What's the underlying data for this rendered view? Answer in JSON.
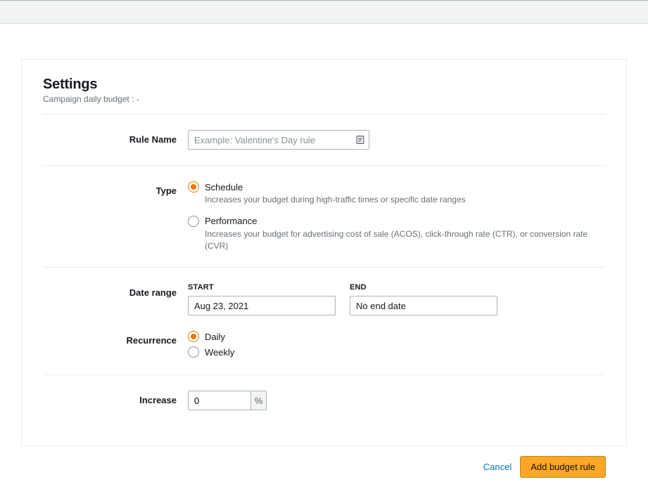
{
  "panel": {
    "title": "Settings",
    "subtitle": "Campaign daily budget : -"
  },
  "ruleName": {
    "label": "Rule Name",
    "placeholder": "Example: Valentine's Day rule",
    "value": ""
  },
  "type": {
    "label": "Type",
    "options": [
      {
        "value": "schedule",
        "label": "Schedule",
        "description": "Increases your budget during high-traffic times or specific date ranges",
        "selected": true
      },
      {
        "value": "performance",
        "label": "Performance",
        "description": "Increases your budget for advertising cost of sale (ACOS), click-through rate (CTR), or conversion rate (CVR)",
        "selected": false
      }
    ]
  },
  "dateRange": {
    "label": "Date range",
    "start": {
      "header": "START",
      "value": "Aug 23, 2021"
    },
    "end": {
      "header": "END",
      "value": "No end date"
    }
  },
  "recurrence": {
    "label": "Recurrence",
    "options": [
      {
        "value": "daily",
        "label": "Daily",
        "selected": true
      },
      {
        "value": "weekly",
        "label": "Weekly",
        "selected": false
      }
    ]
  },
  "increase": {
    "label": "Increase",
    "value": "0",
    "unit": "%"
  },
  "footer": {
    "cancel": "Cancel",
    "submit": "Add budget rule"
  }
}
